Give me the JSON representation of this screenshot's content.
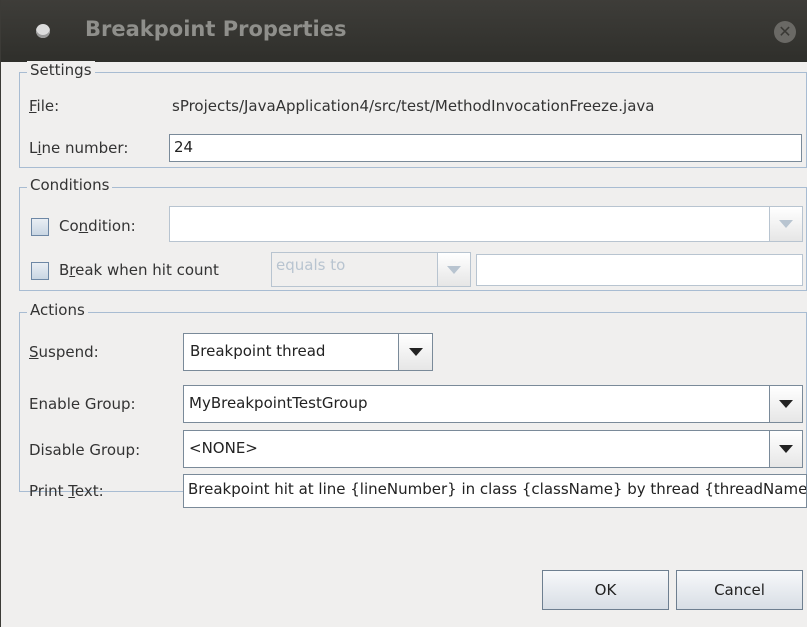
{
  "dialog": {
    "title": "Breakpoint Properties"
  },
  "settings": {
    "legend": "Settings",
    "file_label_pre": "",
    "file_label_mn": "F",
    "file_label_post": "ile:",
    "file_value": "sProjects/JavaApplication4/src/test/MethodInvocationFreeze.java",
    "line_label_pre": "L",
    "line_label_mn": "i",
    "line_label_post": "ne number:",
    "line_value": "24"
  },
  "conditions": {
    "legend": "Conditions",
    "condition_label_pre": "Co",
    "condition_label_mn": "n",
    "condition_label_post": "dition:",
    "condition_checked": false,
    "condition_value": "",
    "hitcount_label_pre": "B",
    "hitcount_label_mn": "r",
    "hitcount_label_post": "eak when hit count",
    "hitcount_checked": false,
    "hitcount_mode": "equals to",
    "hitcount_value": ""
  },
  "actions": {
    "legend": "Actions",
    "suspend_label_mn": "S",
    "suspend_label_post": "uspend:",
    "suspend_value": "Breakpoint thread",
    "enable_label": "Enable Group:",
    "enable_value": "MyBreakpointTestGroup",
    "disable_label": "Disable Group:",
    "disable_value": "<NONE>",
    "print_label_pre": "Print ",
    "print_label_mn": "T",
    "print_label_post": "ext:",
    "print_value": "Breakpoint hit at line {lineNumber} in class {className} by thread {threadName}."
  },
  "buttons": {
    "ok": "OK",
    "cancel": "Cancel"
  }
}
